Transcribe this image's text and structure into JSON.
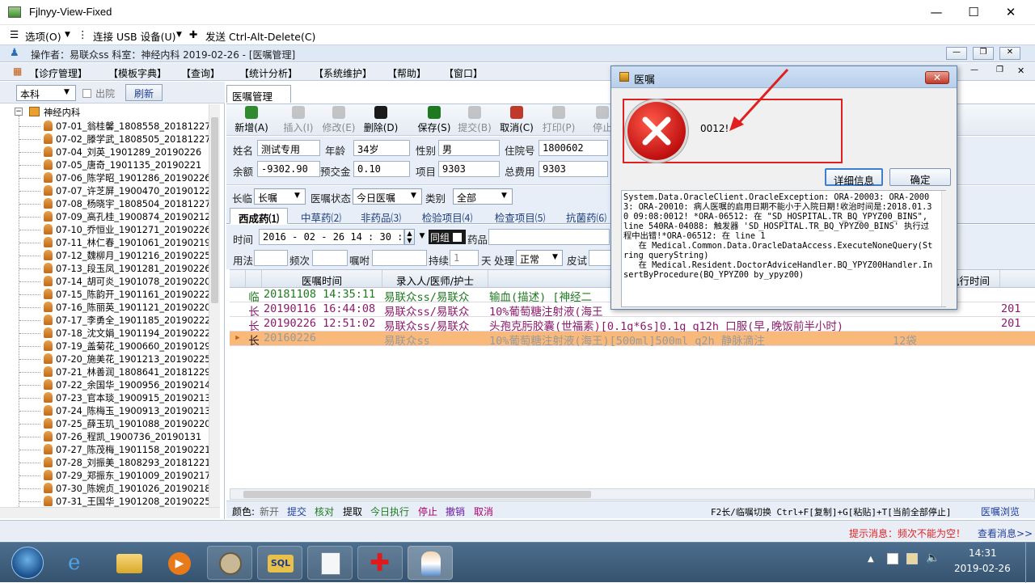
{
  "window": {
    "title": "Fjlnyy-View-Fixed"
  },
  "vm_menu": {
    "options": "选项(O)",
    "usb": "连接 USB 设备(U)",
    "cad": "发送 Ctrl-Alt-Delete(C)"
  },
  "app_header": "操作者：易联众ss   科室：神经内科   2019-02-26 - [医嘱管理]",
  "menu": [
    "【诊疗管理】",
    "【模板字典】",
    "【查询】",
    "【统计分析】",
    "【系统维护】",
    "【帮助】",
    "【窗口】"
  ],
  "left": {
    "dept_select": "本科",
    "discharged_label": "出院",
    "refresh_label": "刷新",
    "root": "神经内科",
    "patients": [
      "07-01_翁桂馨_1808558_20181227",
      "07-02_滕学武_1808505_20181227",
      "07-04_刘英_1901289_20190226",
      "07-05_唐奇_1901135_20190221",
      "07-06_陈学昭_1901286_20190226",
      "07-07_许芝屏_1900470_20190122",
      "07-08_杨晓宇_1808504_20181227",
      "07-09_高孔桂_1900874_20190212",
      "07-10_乔恒业_1901271_20190226",
      "07-11_林仁春_1901061_20190219",
      "07-12_魏柳月_1901216_20190225",
      "07-13_段玉凤_1901281_20190226",
      "07-14_胡可炎_1901078_20190220",
      "07-15_陈韵开_1901161_20190222",
      "07-16_陈丽英_1901121_20190220",
      "07-17_李勇全_1901185_20190222",
      "07-18_沈文娟_1901194_20190222",
      "07-19_盖菊花_1900660_20190129",
      "07-20_施美花_1901213_20190225",
      "07-21_林善润_1808641_20181229",
      "07-22_余国华_1900956_20190214",
      "07-23_官本琰_1900915_20190213",
      "07-24_陈梅玉_1900913_20190213",
      "07-25_薛玉玑_1901088_20190220",
      "07-26_程凯_1900736_20190131",
      "07-27_陈茂梅_1901158_20190221",
      "07-28_刘振美_1808293_20181221",
      "07-29_郑振东_1901009_20190217",
      "07-30_陈婉贞_1901026_20190218",
      "07-31_王国华_1901208_20190225"
    ]
  },
  "main_tab": "医嘱管理",
  "toolbar": [
    {
      "label": "新增(A)",
      "icon": "add-icon",
      "color": "#2e8b2e",
      "enabled": true
    },
    {
      "label": "插入(I)",
      "icon": "insert-icon",
      "color": "#9a9a9a",
      "enabled": false
    },
    {
      "label": "修改(E)",
      "icon": "edit-icon",
      "color": "#9a9a9a",
      "enabled": false
    },
    {
      "label": "删除(D)",
      "icon": "delete-icon",
      "color": "#1a1a1a",
      "enabled": true
    },
    {
      "label": "保存(S)",
      "icon": "save-icon",
      "color": "#1e7a1e",
      "enabled": true
    },
    {
      "label": "提交(B)",
      "icon": "submit-icon",
      "color": "#9a9a9a",
      "enabled": false
    },
    {
      "label": "取消(C)",
      "icon": "undo-icon",
      "color": "#c0392b",
      "enabled": true
    },
    {
      "label": "打印(P)",
      "icon": "print-icon",
      "color": "#9a9a9a",
      "enabled": false
    },
    {
      "label": "停止",
      "icon": "stop-icon",
      "color": "#9a9a9a",
      "enabled": false
    }
  ],
  "patient": {
    "name_label": "姓名",
    "name": "测试专用",
    "age_label": "年龄",
    "age": "34岁",
    "sex_label": "性别",
    "sex": "男",
    "inpatient_label": "住院号",
    "inpatient": "1800602",
    "balance_label": "余额",
    "balance": "-9302.90",
    "deposit_label": "预交金",
    "deposit": "0.10",
    "item_label": "项目",
    "item": "9303",
    "total_label": "总费用",
    "total": "9303"
  },
  "filter": {
    "longterm_label": "长临",
    "longterm": "长嘱",
    "status_label": "医嘱状态",
    "status": "今日医嘱",
    "category_label": "类别",
    "category": "全部"
  },
  "subtabs": [
    "西成药⑴",
    "中草药⑵",
    "非药品⑶",
    "检验项目⑷",
    "检查项目⑸",
    "抗菌药⑹"
  ],
  "time_row": {
    "label": "时间",
    "value": "2016 - 02 - 26   14 : 30 : 04",
    "group_label": "同组",
    "drug_label": "药品"
  },
  "usage_row": {
    "usage": "用法",
    "freq": "频次",
    "instruction": "嘱咐",
    "continue": "持续",
    "continue_value": "1",
    "day": "天",
    "handle": "处理",
    "handle_value": "正常",
    "skin": "皮试"
  },
  "grid": {
    "headers": [
      "医嘱时间",
      "录入人/医师/护士",
      "执行时间"
    ],
    "rows": [
      {
        "type": "临",
        "time": "20181108 14:35:11",
        "who": "易联众ss/易联众",
        "content": "输血(描述)   [神经二",
        "qty": "",
        "exec": "",
        "color": "#1f7a1f"
      },
      {
        "type": "长",
        "time": "20190116 16:44:08",
        "who": "易联众ss/易联众",
        "content": "10%葡萄糖注射液(海王",
        "qty": "",
        "exec": "201",
        "color": "#8b1a6b"
      },
      {
        "type": "长",
        "time": "20190226 12:51:02",
        "who": "易联众ss/易联众",
        "content": "头孢克肟胶囊(世福素)[0.1g*6s]0.1g q12h 口服(早,晚饭前半小时)",
        "qty": "",
        "exec": "201",
        "color": "#8b1a6b"
      },
      {
        "type": "长",
        "time": "20160226",
        "who": "易联众ss",
        "content": "10%葡萄糖注射液(海王)[500ml]500ml q2h 静脉滴注",
        "qty": "12袋",
        "exec": "",
        "color": "#e0e0e0"
      }
    ]
  },
  "legend": {
    "color_label": "颜色:",
    "items": [
      {
        "text": "新开",
        "color": "#666666"
      },
      {
        "text": "提交",
        "color": "#1f3f9a"
      },
      {
        "text": "核对",
        "color": "#1f7a1f"
      },
      {
        "text": "提取",
        "color": "#000000"
      },
      {
        "text": "今日执行",
        "color": "#1f7a1f"
      },
      {
        "text": "停止",
        "color": "#b0006a"
      },
      {
        "text": "撤销",
        "color": "#6a1a9a"
      },
      {
        "text": "取消",
        "color": "#b0006a"
      }
    ],
    "shortcuts": "F2长/临嘱切换 Ctrl+F[复制]+G[粘贴]+T[当前全部停止]",
    "browse": "医嘱浏览"
  },
  "status": {
    "message": "提示消息：频次不能为空！",
    "view": "查看消息>>"
  },
  "dialog": {
    "title": "医嘱",
    "code": "0012!",
    "details_btn": "详细信息",
    "ok_btn": "确定",
    "details_text": "System.Data.OracleClient.OracleException: ORA-20003: ORA-20003: ORA-20010: 病人医嘱的启用日期不能小于入院日期!收治时间是:2018.01.30 09:08:0012! *ORA-06512: 在 \"SD_HOSPITAL.TR_BQ_YPYZ00_BINS\", line 540RA-04088: 触发器 'SD_HOSPITAL.TR_BQ_YPYZ00_BINS' 执行过程中出错!*ORA-06512: 在 line 1\n   在 Medical.Common.Data.OracleDataAccess.ExecuteNoneQuery(String queryString)\n   在 Medical.Resident.DoctorAdviceHandler.BQ_YPYZ00Handler.InsertByProcedure(BQ_YPYZ00 by_ypyz00)"
  },
  "taskbar": {
    "time": "14:31",
    "date": "2019-02-26"
  }
}
